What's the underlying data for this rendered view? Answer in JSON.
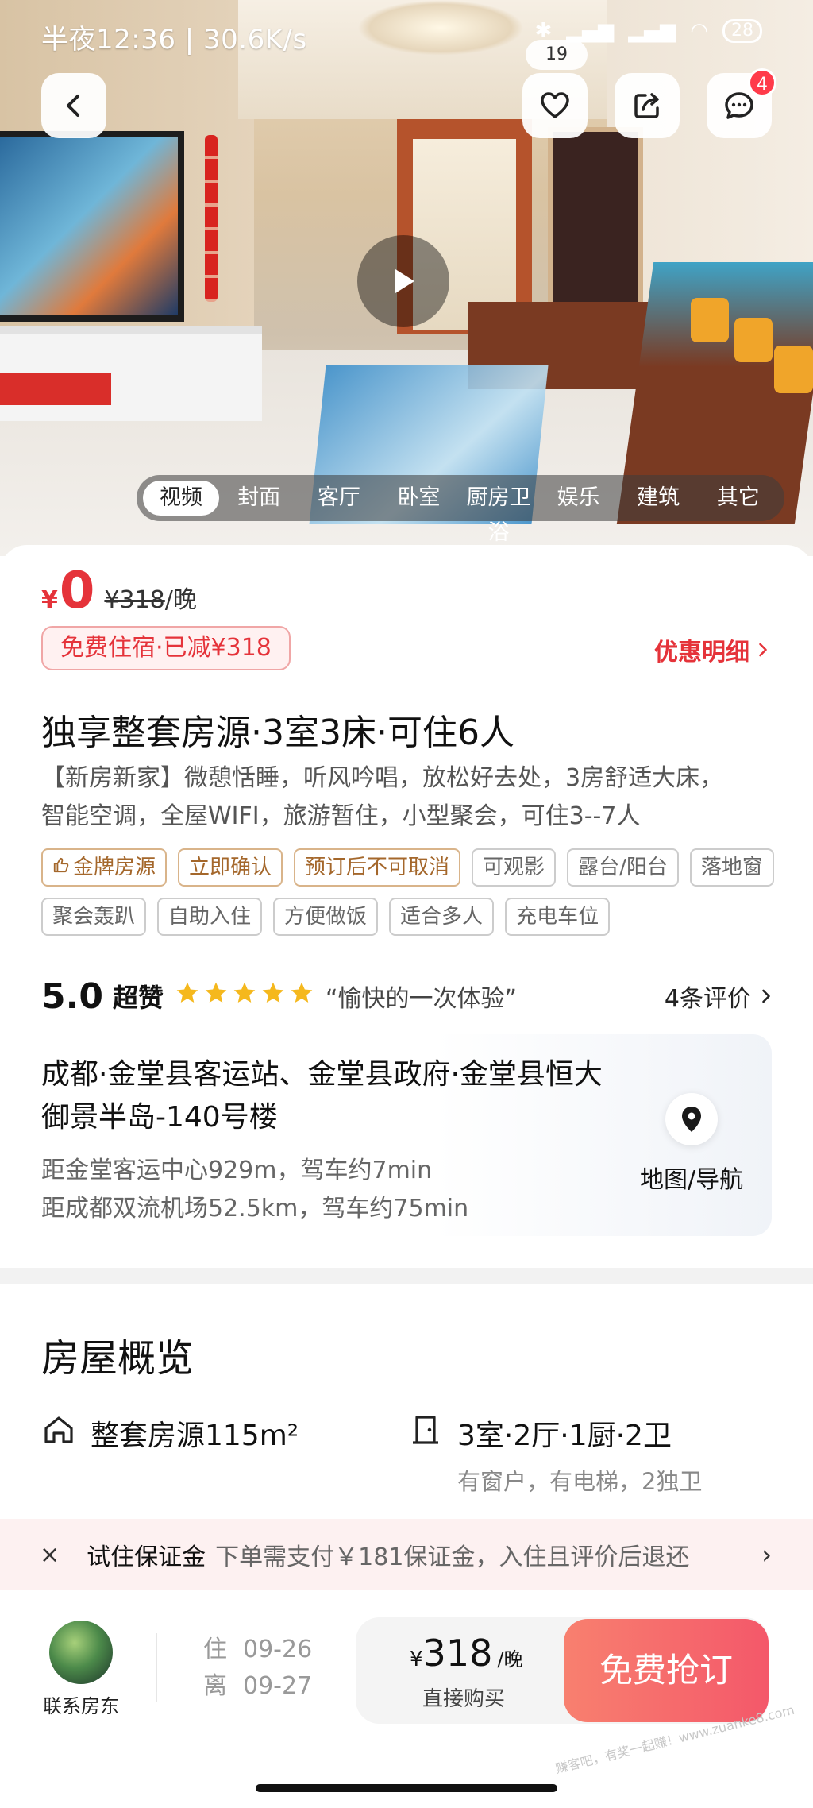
{
  "status_bar": {
    "time": "半夜12:36 | 30.6K/s",
    "battery": "28"
  },
  "hero": {
    "page_counter": "19",
    "notification_count": "4",
    "media_tabs": [
      "视频",
      "封面",
      "客厅",
      "卧室",
      "厨房卫浴",
      "娱乐",
      "建筑",
      "其它"
    ],
    "active_tab": "视频"
  },
  "price": {
    "currency": "¥",
    "current": "0",
    "original": "¥318",
    "unit": "/晚",
    "free_tag": "免费住宿·已减¥318",
    "discount_link": "优惠明细"
  },
  "listing": {
    "title": "独享整套房源·3室3床·可住6人",
    "description_line1": "【新房新家】微憩恬睡，听风吟唱，放松好去处，3房舒适大床，",
    "description_line2": "智能空调，全屋WIFI，旅游暂住，小型聚会，可住3--7人",
    "tags": [
      {
        "label": "金牌房源",
        "gold": true
      },
      {
        "label": "立即确认",
        "gold": true
      },
      {
        "label": "预订后不可取消",
        "gold": true
      },
      {
        "label": "可观影",
        "gold": false
      },
      {
        "label": "露台/阳台",
        "gold": false
      },
      {
        "label": "落地窗",
        "gold": false
      },
      {
        "label": "聚会轰趴",
        "gold": false
      },
      {
        "label": "自助入住",
        "gold": false
      },
      {
        "label": "方便做饭",
        "gold": false
      },
      {
        "label": "适合多人",
        "gold": false
      },
      {
        "label": "充电车位",
        "gold": false
      }
    ]
  },
  "rating": {
    "score": "5.0",
    "label": "超赞",
    "stars": 5,
    "quote": "“愉快的一次体验”",
    "reviews": "4条评价"
  },
  "address": {
    "line1": "成都·金堂县客运站、金堂县政府·金堂县恒大",
    "line2": "御景半岛-140号楼",
    "distance1": "距金堂客运中心929m，驾车约7min",
    "distance2": "距成都双流机场52.5km，驾车约75min",
    "map_label": "地图/导航"
  },
  "overview": {
    "title": "房屋概览",
    "area": "整套房源115m²",
    "rooms": "3室·2厅·1厨·2卫",
    "rooms_detail": "有窗户，有电梯，2独卫"
  },
  "deposit": {
    "close": "×",
    "label": "试住保证金",
    "text": "下单需支付￥181保证金，入住且评价后退还",
    "arrow": "›"
  },
  "bottom": {
    "contact_label": "联系房东",
    "checkin_key": "住",
    "checkin_date": "09-26",
    "checkout_key": "离",
    "checkout_date": "09-27",
    "buy_currency": "¥",
    "buy_price": "318",
    "buy_unit": "/晚",
    "buy_label": "直接购买",
    "book_button": "免费抢订",
    "watermark": "赚客吧，有奖一起赚！www.zuanke8.com"
  },
  "colors": {
    "accent": "#e5333a",
    "star": "#f5b81d",
    "tag_gold": "#a4672b",
    "book_button": "#f4586a"
  }
}
